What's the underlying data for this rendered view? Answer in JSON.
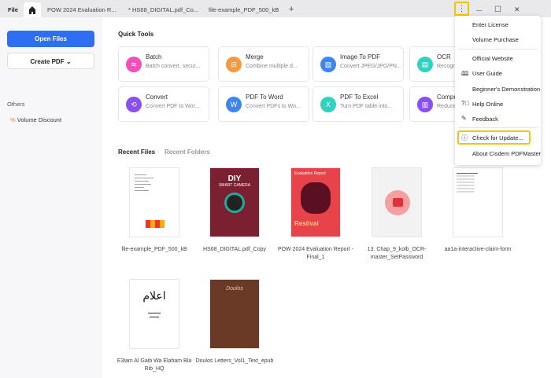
{
  "titlebar": {
    "file": "File",
    "tabs": [
      "POW 2024 Evaluation R...",
      "* HS68_DIGITAL.pdf_Co...",
      "file-example_PDF_500_kB"
    ],
    "new_tab": "+",
    "more": "⋮",
    "minimize": "—",
    "maximize": "☐",
    "close": "✕"
  },
  "sidebar": {
    "open_files": "Open Files",
    "create_pdf": "Create PDF",
    "others": "Others",
    "volume_discount": "Volume Discount"
  },
  "quick_tools": {
    "title": "Quick Tools",
    "items": [
      {
        "title": "Batch",
        "desc": "Batch convert, secur...",
        "color": "#f050b8"
      },
      {
        "title": "Merge",
        "desc": "Combine multiple d...",
        "color": "#f59a42"
      },
      {
        "title": "Image To PDF",
        "desc": "Convert JPEG/JPG/PN...",
        "color": "#3d86f0"
      },
      {
        "title": "OCR",
        "desc": "Recogniz",
        "color": "#2ed3c0"
      },
      {
        "title": "Convert",
        "desc": "Convert PDF to Wor...",
        "color": "#8a4ff0"
      },
      {
        "title": "PDF To Word",
        "desc": "Convert PDFs to Wo...",
        "color": "#3d86f0"
      },
      {
        "title": "PDF To Excel",
        "desc": "Turn PDF table into...",
        "color": "#2ed3c0"
      },
      {
        "title": "Compre",
        "desc": "Reduce f",
        "color": "#8a4ff0"
      }
    ]
  },
  "recent": {
    "tab_files": "Recent Files",
    "tab_folders": "Recent Folders",
    "files": [
      "file-example_PDF_500_kB",
      "HS68_DIGITAL.pdf_Copy",
      "POW 2024 Evaluation Report - Final_1",
      "13. Chap_9_kolb_OCR-master_SetPassword",
      "aa1a-interactive-claim-form",
      "E3lam Al Gaib Wa Elaham Bla Rib_HQ",
      "Doulos Letters_Vol1_Text_epub"
    ],
    "thumb_text": {
      "diy": "DIY",
      "smart": "SMART CAMERA",
      "eval": "Evaluation Report",
      "restival": "Restival",
      "doulos": "Doulos"
    }
  },
  "menu": {
    "items": [
      "Enter License",
      "Volume Purchase",
      "Official Website",
      "User Guide",
      "Beginner's Demonstration",
      "Help Online",
      "Feedback",
      "Check for Update...",
      "About Cisdem PDFMaster"
    ]
  },
  "colors": {
    "accent": "#2f6ef0",
    "highlight": "#f5c400"
  }
}
